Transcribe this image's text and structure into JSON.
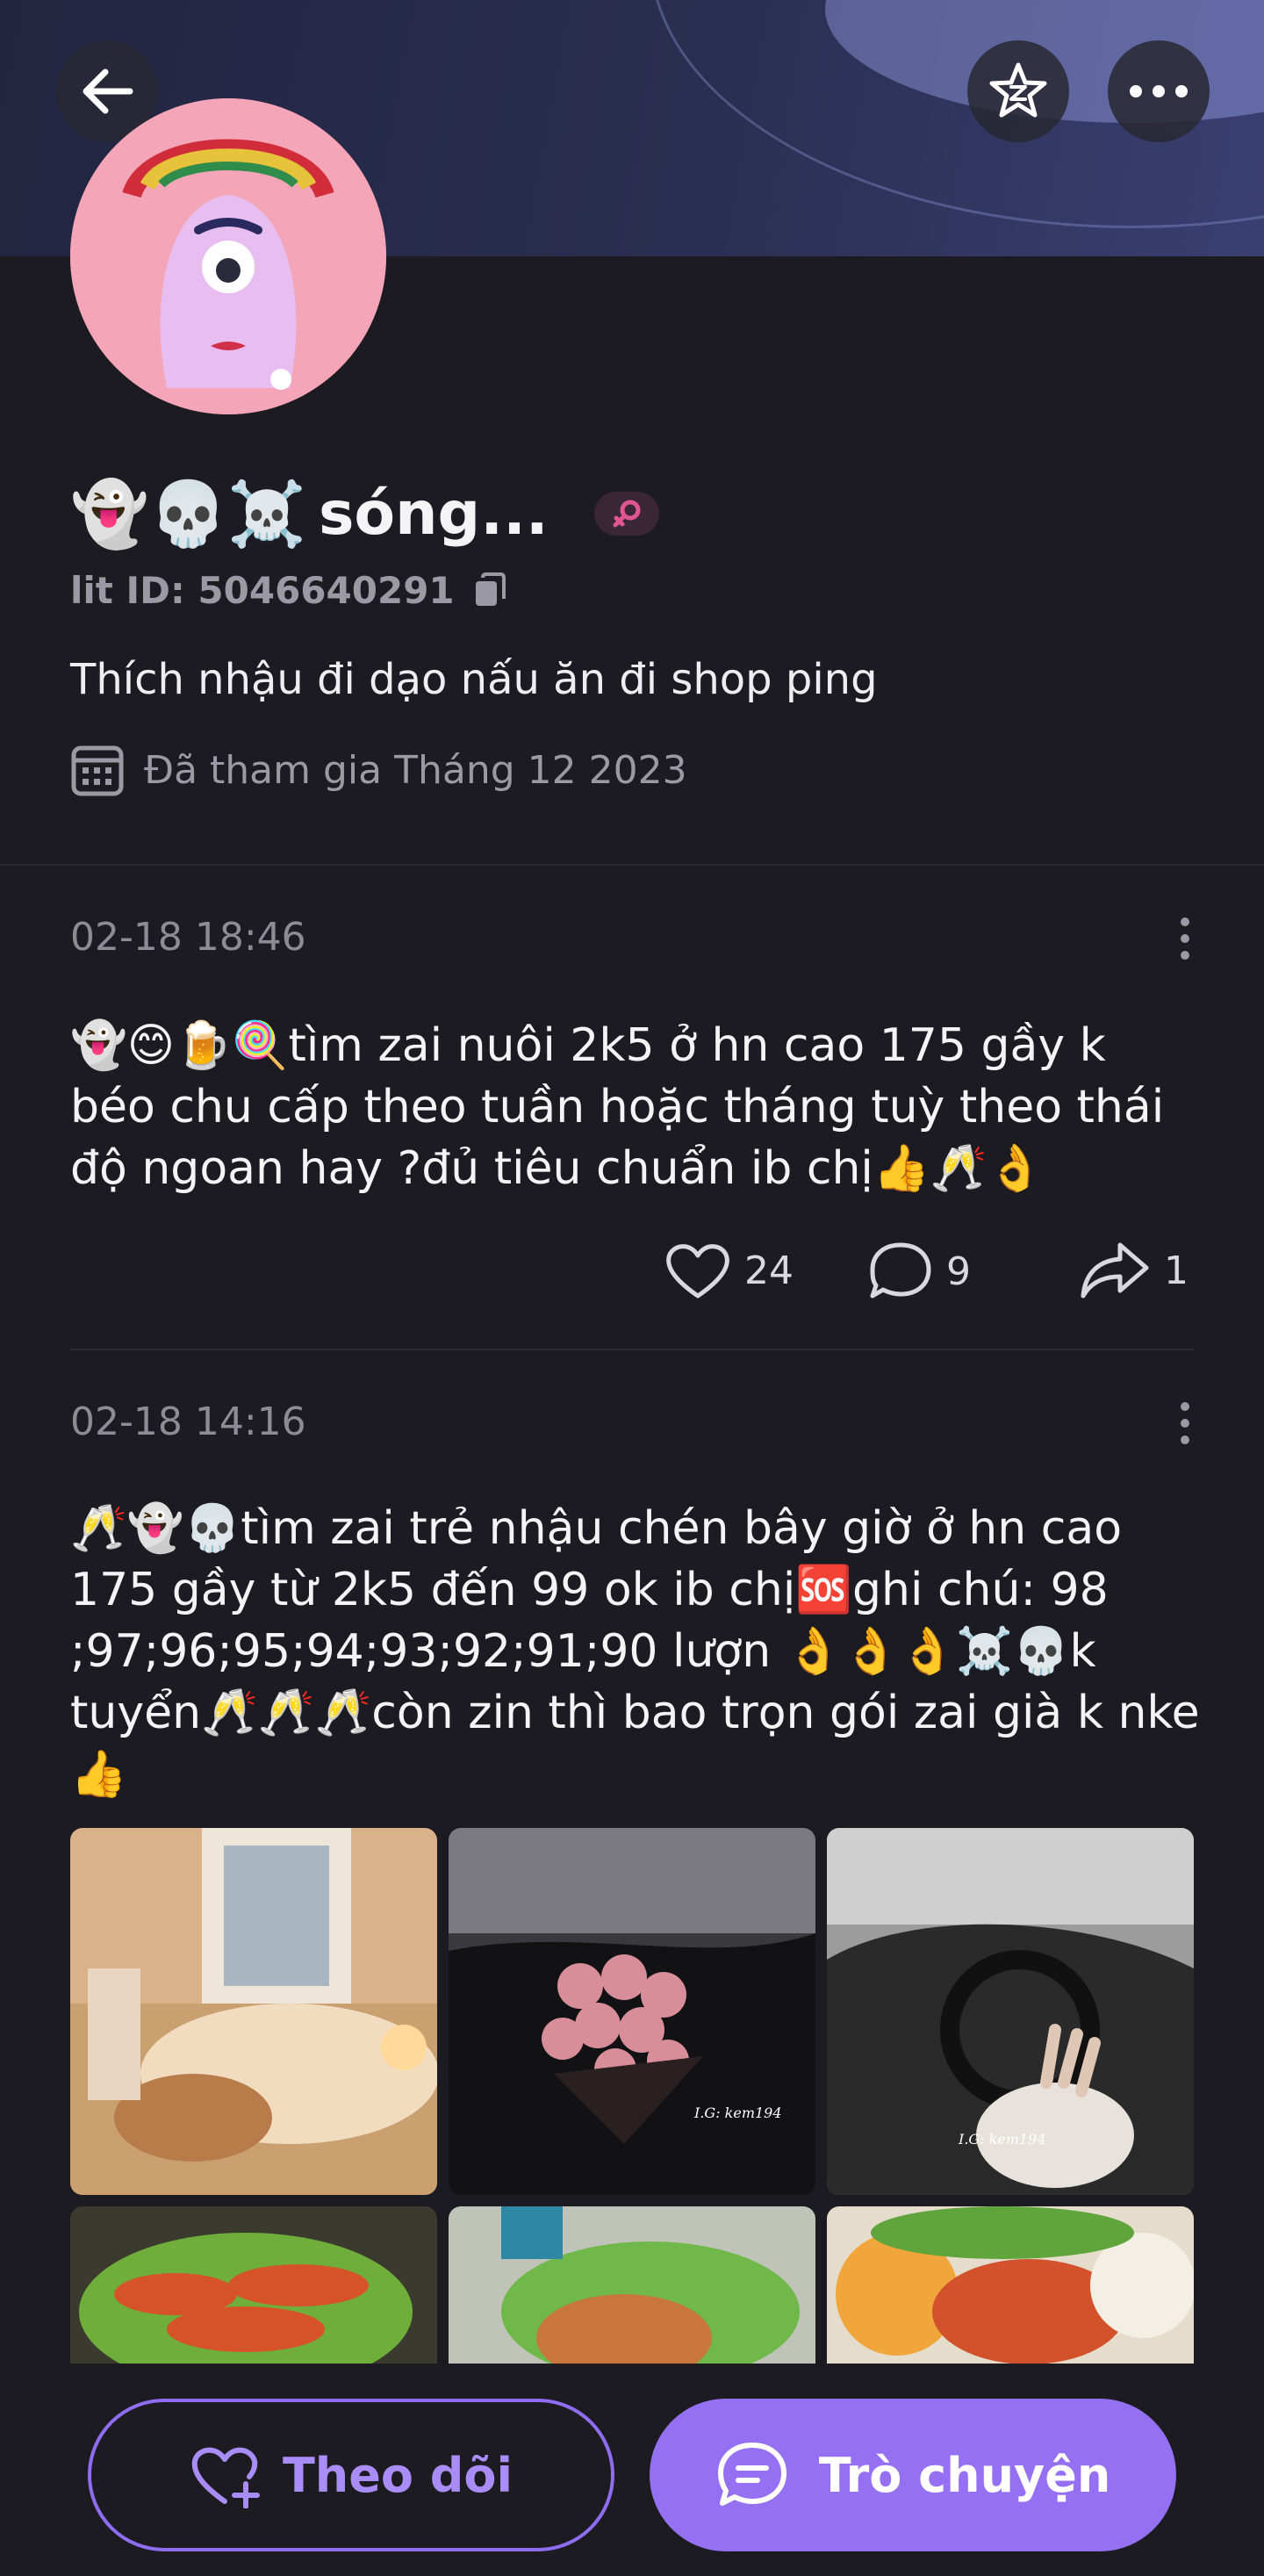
{
  "profile": {
    "name_emojis": "👻💀☠️",
    "name": "sóng...",
    "lit_id": "lit ID: 5046640291",
    "bio": "Thích nhậu đi dạo nấu ăn đi shop ping",
    "joined": "Đã tham gia Tháng 12 2023"
  },
  "posts": [
    {
      "date": "02-18 18:46",
      "text": "👻😊🍺🍭tìm zai nuôi 2k5 ở hn cao 175 gầy k béo chu cấp theo tuần hoặc tháng tuỳ theo thái độ ngoan hay ?đủ tiêu chuẩn ib chị👍🥂👌",
      "likes": "24",
      "comments": "9",
      "shares": "1"
    },
    {
      "date": "02-18 14:16",
      "text": "🥂👻💀tìm zai trẻ nhậu chén bây giờ ở hn cao 175 gầy từ 2k5 đến 99 ok ib chị🆘ghi chú: 98 ;97;96;95;94;93;92;91;90 lượn 👌👌👌☠️💀k tuyển🥂🥂🥂còn zin thì bao trọn gói zai già k nke 👍",
      "image_watermarks": [
        "I.G: kem194",
        "I.G: kem194"
      ]
    }
  ],
  "actions": {
    "follow_label": "Theo dõi",
    "chat_label": "Trò chuyện"
  },
  "colors": {
    "background": "#1c1b22",
    "accent": "#9670f3",
    "muted_text": "#9a99a4"
  }
}
